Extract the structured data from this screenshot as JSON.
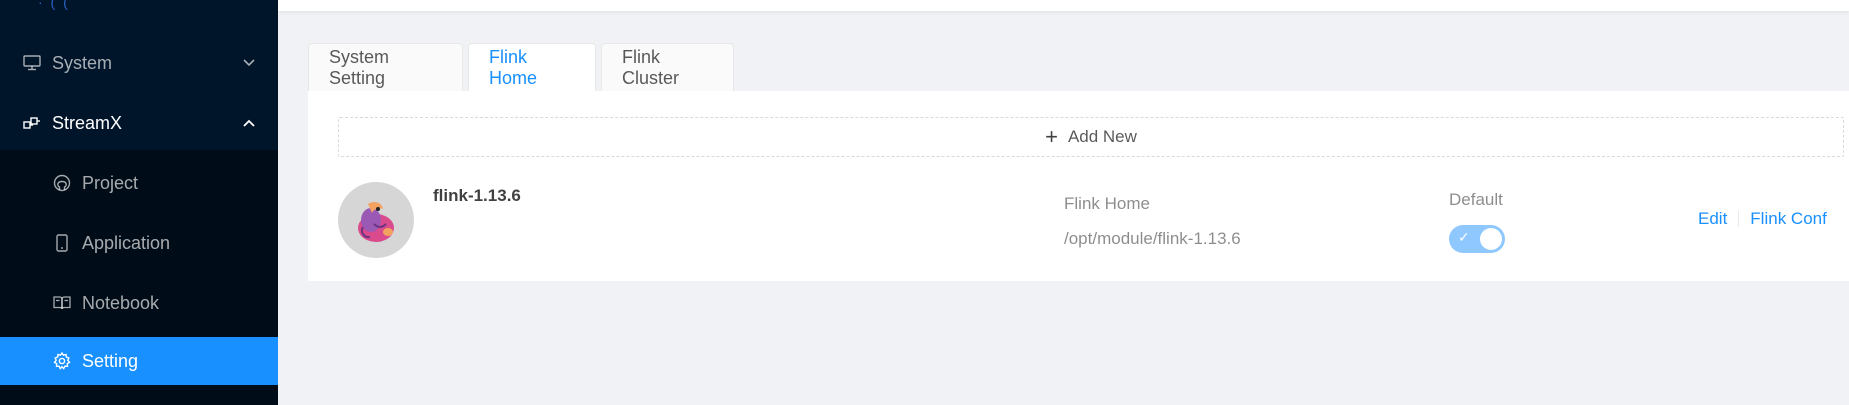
{
  "sidebar": {
    "logo_fragment": "· ( (",
    "menu": [
      {
        "label": "System",
        "icon": "desktop-icon",
        "expanded": false
      },
      {
        "label": "StreamX",
        "icon": "cluster-icon",
        "expanded": true,
        "children": [
          {
            "label": "Project",
            "icon": "github-icon"
          },
          {
            "label": "Application",
            "icon": "mobile-icon"
          },
          {
            "label": "Notebook",
            "icon": "read-icon"
          },
          {
            "label": "Setting",
            "icon": "setting-icon",
            "selected": true
          }
        ]
      }
    ]
  },
  "tabs": [
    {
      "label": "System Setting",
      "active": false
    },
    {
      "label": "Flink Home",
      "active": true
    },
    {
      "label": "Flink Cluster",
      "active": false
    }
  ],
  "add_new": {
    "label": "Add New",
    "icon": "plus-icon"
  },
  "flink_list": [
    {
      "name": "flink-1.13.6",
      "home_label": "Flink Home",
      "home_path": "/opt/module/flink-1.13.6",
      "default_label": "Default",
      "is_default": true,
      "actions": {
        "edit": "Edit",
        "conf": "Flink Conf"
      }
    }
  ],
  "colors": {
    "sidebar_bg": "#001529",
    "submenu_bg": "#000c17",
    "accent": "#1890ff",
    "switch_on": "#8fc8ff"
  }
}
